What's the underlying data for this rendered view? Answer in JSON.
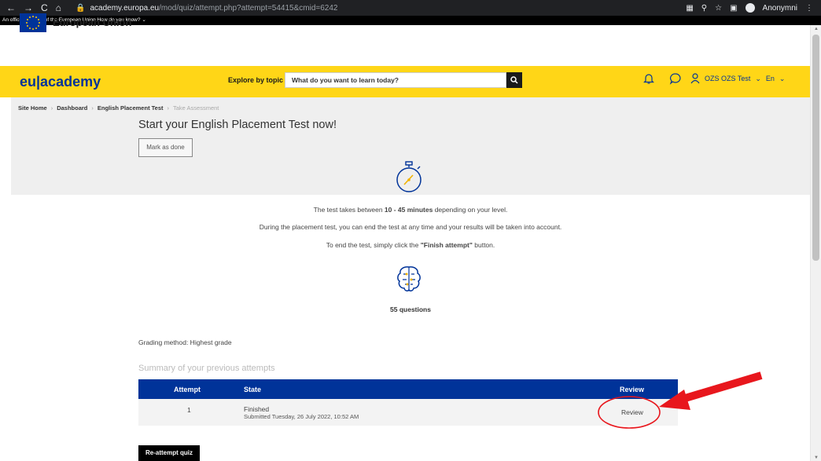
{
  "browser": {
    "nav_glyphs": [
      "←",
      "→",
      "C",
      "⌂"
    ],
    "url_host": "academy.europa.eu",
    "url_path": "/mod/quiz/attempt.php?attempt=54415&cmid=6242",
    "profile_label": "Anonymni"
  },
  "official_banner": "An official website of the European Union   How do you know?",
  "eu_header": {
    "name": "European Union"
  },
  "topbar": {
    "brand": "eu|academy",
    "explore_label": "Explore by topic",
    "search_placeholder": "What do you want to learn today?",
    "user_label": "OZS OZS Test",
    "language_label": "En"
  },
  "breadcrumb": {
    "items": [
      "Site Home",
      "Dashboard",
      "English Placement Test"
    ],
    "current": "Take Assessment"
  },
  "page": {
    "title": "Start your English Placement Test now!",
    "mark_done_label": "Mark as done"
  },
  "info": {
    "line1_pre": "The test takes between ",
    "line1_bold": "10 - 45 minutes",
    "line1_post": " depending on your level.",
    "line2": "During the placement test, you can end the test at any time and your results will be taken into account.",
    "line3_pre": "To end the test, simply click the ",
    "line3_bold": "\"Finish attempt\"",
    "line3_post": " button."
  },
  "questions_label": "55 questions",
  "grading_method": "Grading method: Highest grade",
  "summary_heading": "Summary of your previous attempts",
  "attempts_table": {
    "headers": [
      "Attempt",
      "State",
      "Review"
    ],
    "rows": [
      {
        "attempt": "1",
        "state": "Finished",
        "submitted": "Submitted Tuesday, 26 July 2022, 10:52 AM",
        "review_link": "Review"
      }
    ]
  },
  "reattempt_label": "Re-attempt quiz",
  "colors": {
    "eu_blue": "#003399",
    "yellow": "#ffd617",
    "annotation_red": "#e8171d"
  },
  "icons": [
    "stopwatch-icon",
    "brain-icon",
    "search-icon",
    "bell-icon",
    "chat-icon",
    "user-icon",
    "chevron-down-icon"
  ]
}
